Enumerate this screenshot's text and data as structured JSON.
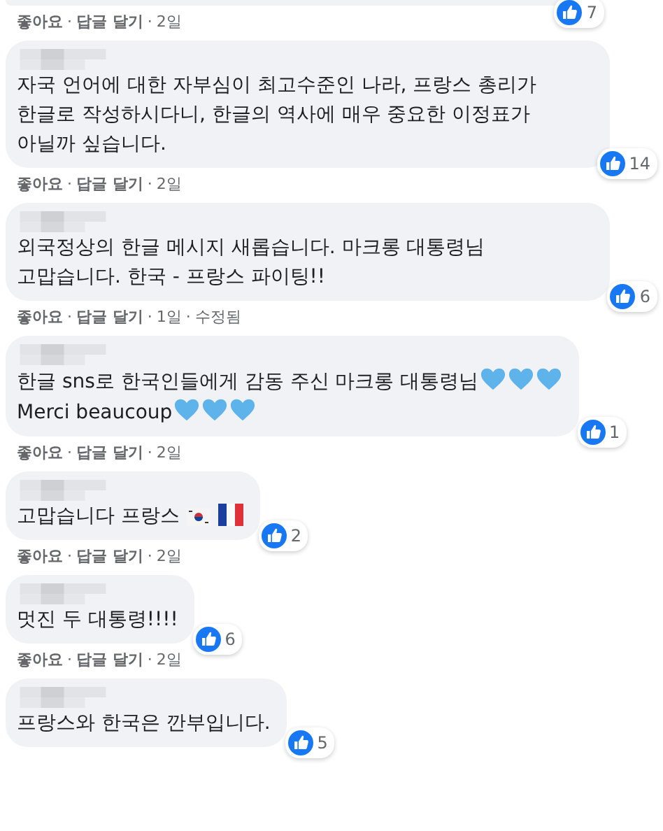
{
  "separator": "·",
  "comments": [
    {
      "reaction_count": "7",
      "meta": [
        {
          "label": "좋아요",
          "kind": "link"
        },
        {
          "label": "답글 달기",
          "kind": "link"
        },
        {
          "label": "2일",
          "kind": "time"
        }
      ]
    },
    {
      "body": [
        {
          "kind": "text",
          "text": "자국 언어에 대한 자부심이 최고수준인 나라, 프랑스 총리가 한글로 작성하시다니, 한글의 역사에 매우 중요한 이정표가 아닐까 싶습니다."
        }
      ],
      "reaction_count": "14",
      "meta": [
        {
          "label": "좋아요",
          "kind": "link"
        },
        {
          "label": "답글 달기",
          "kind": "link"
        },
        {
          "label": "2일",
          "kind": "time"
        }
      ]
    },
    {
      "body": [
        {
          "kind": "text",
          "text": "외국정상의 한글 메시지 새롭습니다. 마크롱 대통령님 고맙습니다. 한국 - 프랑스 파이팅!!"
        }
      ],
      "reaction_count": "6",
      "meta": [
        {
          "label": "좋아요",
          "kind": "link"
        },
        {
          "label": "답글 달기",
          "kind": "link"
        },
        {
          "label": "1일",
          "kind": "time"
        },
        {
          "label": "수정됨",
          "kind": "note"
        }
      ]
    },
    {
      "body": [
        {
          "kind": "text",
          "text": "한글 sns로 한국인들에게 감동 주신 마크롱 대통령님"
        },
        {
          "kind": "heart"
        },
        {
          "kind": "heart"
        },
        {
          "kind": "heart"
        },
        {
          "kind": "break"
        },
        {
          "kind": "text",
          "text": "Merci beaucoup"
        },
        {
          "kind": "heart"
        },
        {
          "kind": "heart"
        },
        {
          "kind": "heart"
        }
      ],
      "reaction_count": "1",
      "meta": [
        {
          "label": "좋아요",
          "kind": "link"
        },
        {
          "label": "답글 달기",
          "kind": "link"
        },
        {
          "label": "2일",
          "kind": "time"
        }
      ]
    },
    {
      "body": [
        {
          "kind": "text",
          "text": "고맙습니다 프랑스"
        },
        {
          "kind": "flag_kr"
        },
        {
          "kind": "flag_fr"
        }
      ],
      "reaction_count": "2",
      "meta": [
        {
          "label": "좋아요",
          "kind": "link"
        },
        {
          "label": "답글 달기",
          "kind": "link"
        },
        {
          "label": "2일",
          "kind": "time"
        }
      ]
    },
    {
      "body": [
        {
          "kind": "text",
          "text": "멋진 두 대통령!!!!"
        }
      ],
      "reaction_count": "6",
      "meta": [
        {
          "label": "좋아요",
          "kind": "link"
        },
        {
          "label": "답글 달기",
          "kind": "link"
        },
        {
          "label": "2일",
          "kind": "time"
        }
      ]
    },
    {
      "body": [
        {
          "kind": "text",
          "text": "프랑스와 한국은 깐부입니다."
        }
      ],
      "reaction_count": "5"
    }
  ]
}
